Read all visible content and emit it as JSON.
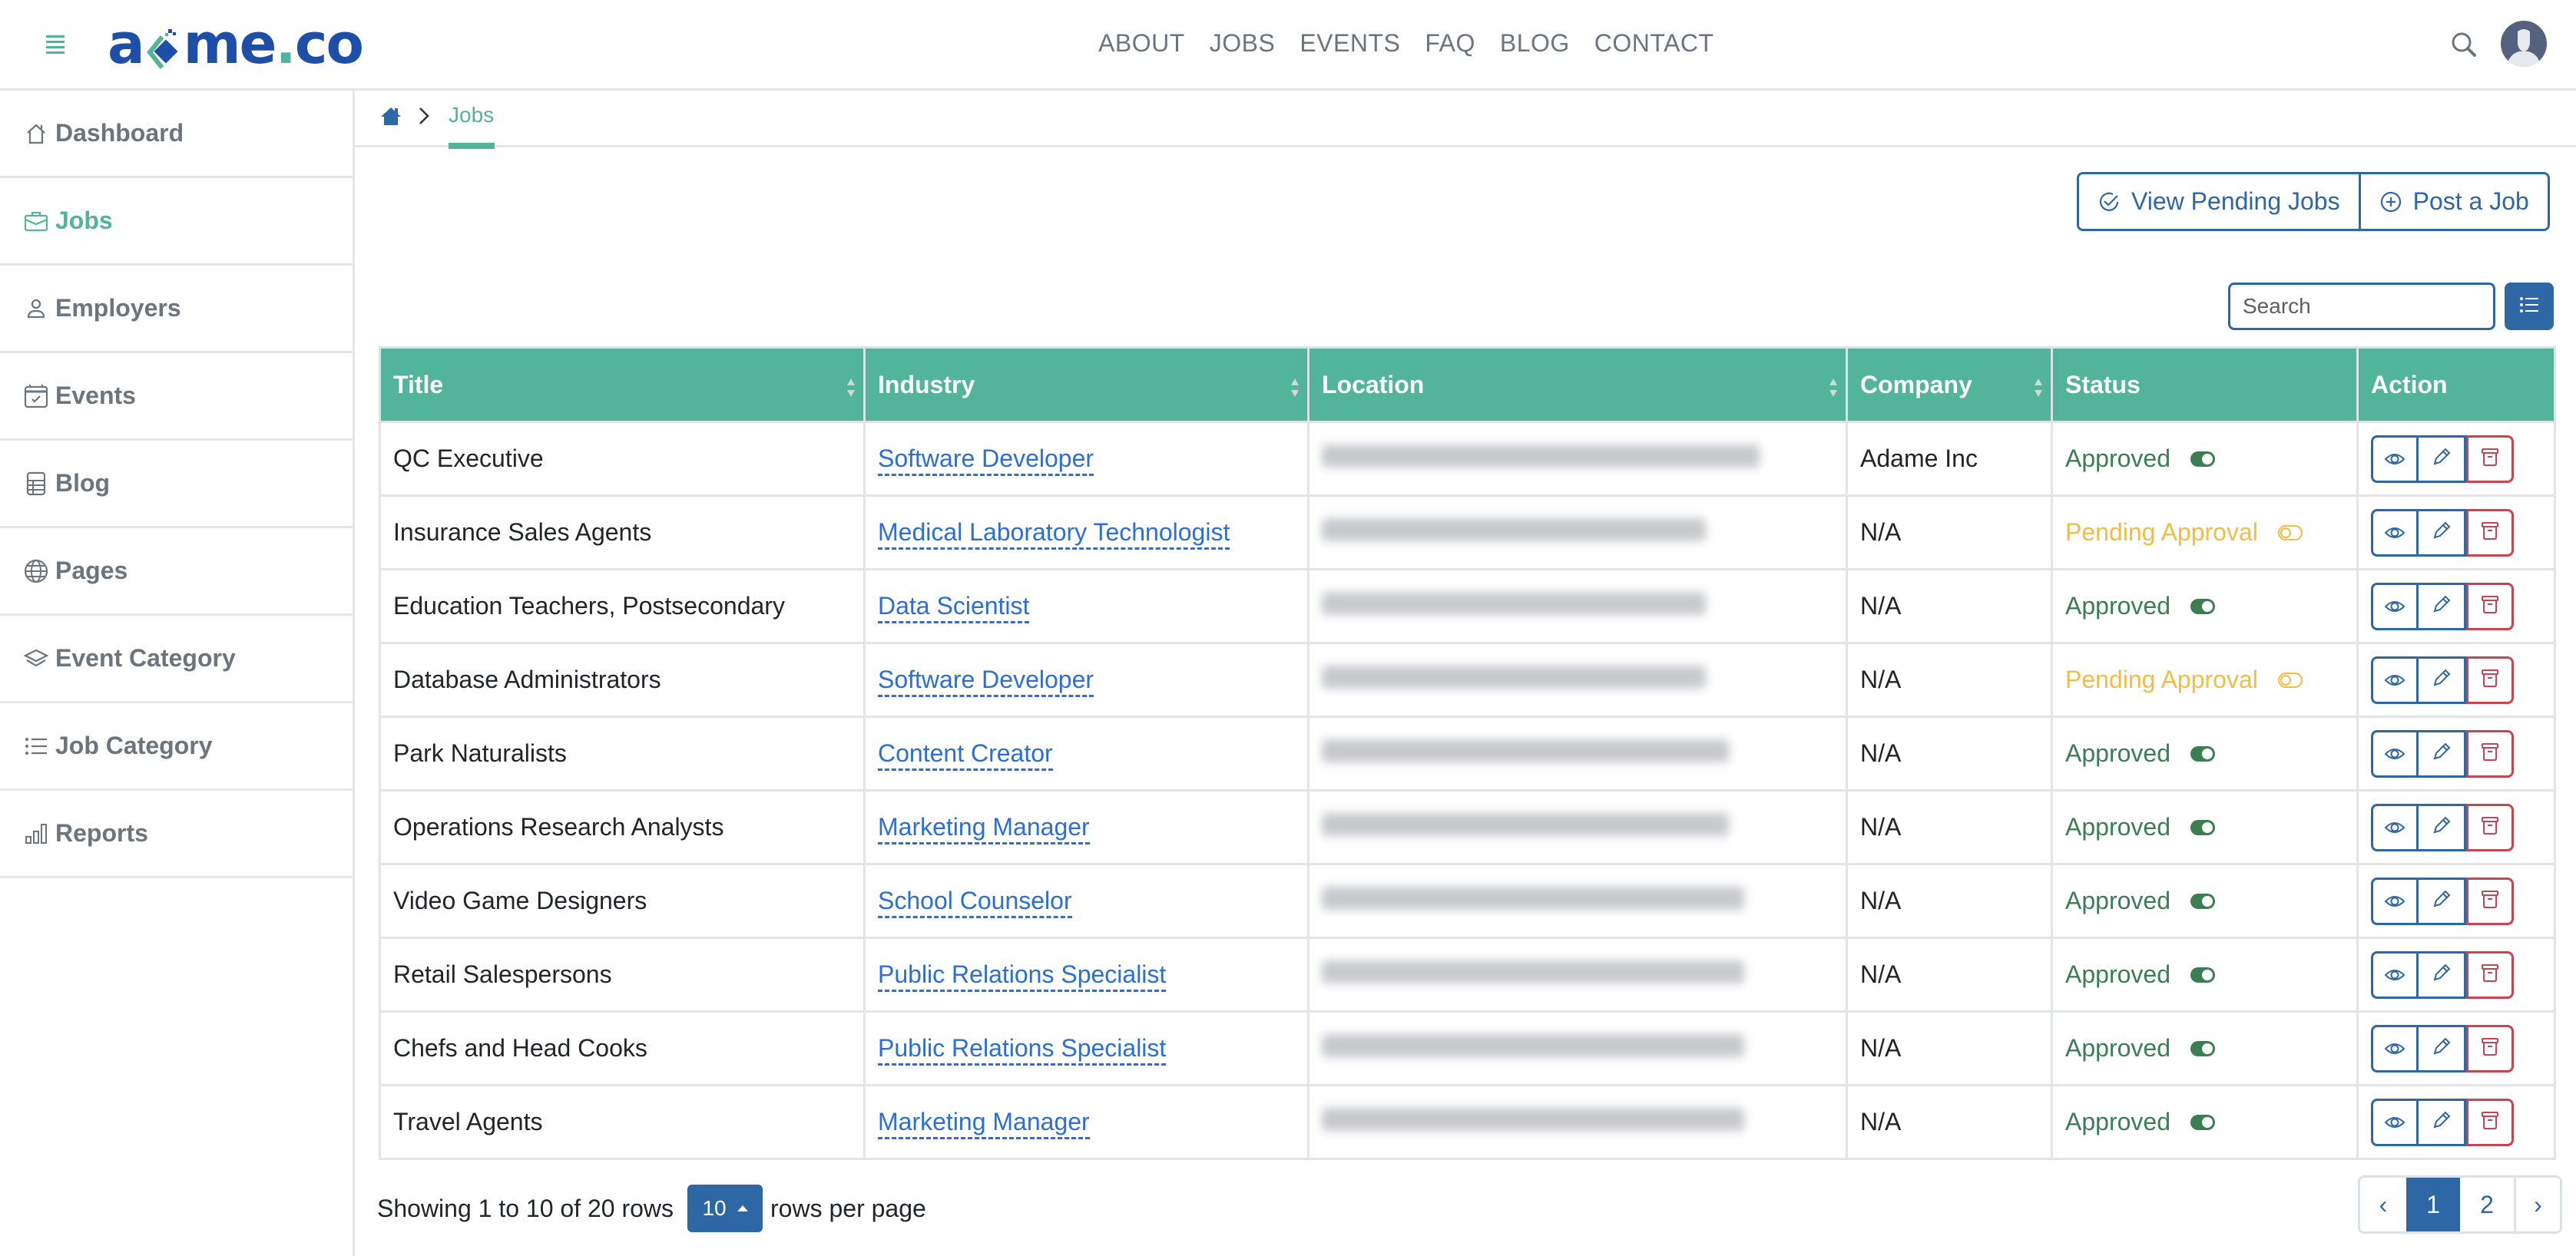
{
  "header": {
    "logo_text_left": "a",
    "logo_text_right": "me",
    "logo_dot": ".",
    "logo_tld": "co",
    "nav": [
      {
        "label": "ABOUT"
      },
      {
        "label": "JOBS"
      },
      {
        "label": "EVENTS"
      },
      {
        "label": "FAQ"
      },
      {
        "label": "BLOG"
      },
      {
        "label": "CONTACT"
      }
    ],
    "search_icon": "search-icon",
    "avatar_icon": "user-avatar-icon"
  },
  "sidebar": {
    "items": [
      {
        "label": "Dashboard",
        "icon": "home-icon",
        "active": false
      },
      {
        "label": "Jobs",
        "icon": "briefcase-icon",
        "active": true
      },
      {
        "label": "Employers",
        "icon": "person-icon",
        "active": false
      },
      {
        "label": "Events",
        "icon": "calendar-check-icon",
        "active": false
      },
      {
        "label": "Blog",
        "icon": "layout-table-icon",
        "active": false
      },
      {
        "label": "Pages",
        "icon": "globe-icon",
        "active": false
      },
      {
        "label": "Event Category",
        "icon": "layers-icon",
        "active": false
      },
      {
        "label": "Job Category",
        "icon": "list-icon",
        "active": false
      },
      {
        "label": "Reports",
        "icon": "bar-chart-icon",
        "active": false
      }
    ]
  },
  "breadcrumb": {
    "home_icon": "home-icon",
    "current": "Jobs"
  },
  "toolbar": {
    "view_pending_label": "View Pending Jobs",
    "post_job_label": "Post a Job",
    "search_placeholder": "Search",
    "search_value": "",
    "columns_icon": "list-icon"
  },
  "colors": {
    "accent": "#52b49a",
    "primary": "#2e67a6",
    "approved": "#3b7e52",
    "pending": "#f2bd43",
    "danger": "#c9444f",
    "link": "#2a6fd6"
  },
  "table": {
    "columns": [
      {
        "label": "Title",
        "sortable": true
      },
      {
        "label": "Industry",
        "sortable": true
      },
      {
        "label": "Location",
        "sortable": true
      },
      {
        "label": "Company",
        "sortable": true
      },
      {
        "label": "Status",
        "sortable": false
      },
      {
        "label": "Action",
        "sortable": false
      }
    ],
    "rows": [
      {
        "title": "QC Executive",
        "industry": "Software Developer",
        "location": "[redacted]",
        "company": "Adame Inc",
        "status": "Approved",
        "status_key": "approved"
      },
      {
        "title": "Insurance Sales Agents",
        "industry": "Medical Laboratory Technologist",
        "location": "[redacted]",
        "company": "N/A",
        "status": "Pending Approval",
        "status_key": "pending"
      },
      {
        "title": "Education Teachers, Postsecondary",
        "industry": "Data Scientist",
        "location": "[redacted]",
        "company": "N/A",
        "status": "Approved",
        "status_key": "approved"
      },
      {
        "title": "Database Administrators",
        "industry": "Software Developer",
        "location": "[redacted]",
        "company": "N/A",
        "status": "Pending Approval",
        "status_key": "pending"
      },
      {
        "title": "Park Naturalists",
        "industry": "Content Creator",
        "location": "[redacted]",
        "company": "N/A",
        "status": "Approved",
        "status_key": "approved"
      },
      {
        "title": "Operations Research Analysts",
        "industry": "Marketing Manager",
        "location": "[redacted]",
        "company": "N/A",
        "status": "Approved",
        "status_key": "approved"
      },
      {
        "title": "Video Game Designers",
        "industry": "School Counselor",
        "location": "[redacted]",
        "company": "N/A",
        "status": "Approved",
        "status_key": "approved"
      },
      {
        "title": "Retail Salespersons",
        "industry": "Public Relations Specialist",
        "location": "[redacted]",
        "company": "N/A",
        "status": "Approved",
        "status_key": "approved"
      },
      {
        "title": "Chefs and Head Cooks",
        "industry": "Public Relations Specialist",
        "location": "[redacted]",
        "company": "N/A",
        "status": "Approved",
        "status_key": "approved"
      },
      {
        "title": "Travel Agents",
        "industry": "Marketing Manager",
        "location": "[redacted]",
        "company": "N/A",
        "status": "Approved",
        "status_key": "approved"
      }
    ],
    "action_icons": [
      "eye-icon",
      "pencil-icon",
      "archive-icon"
    ]
  },
  "footer": {
    "showing_text": "Showing 1 to 10 of 20 rows",
    "rows_per_page_value": "10",
    "rows_per_page_suffix": "rows per page",
    "pagination": {
      "prev": "‹",
      "pages": [
        "1",
        "2"
      ],
      "current": "1",
      "next": "›"
    }
  }
}
